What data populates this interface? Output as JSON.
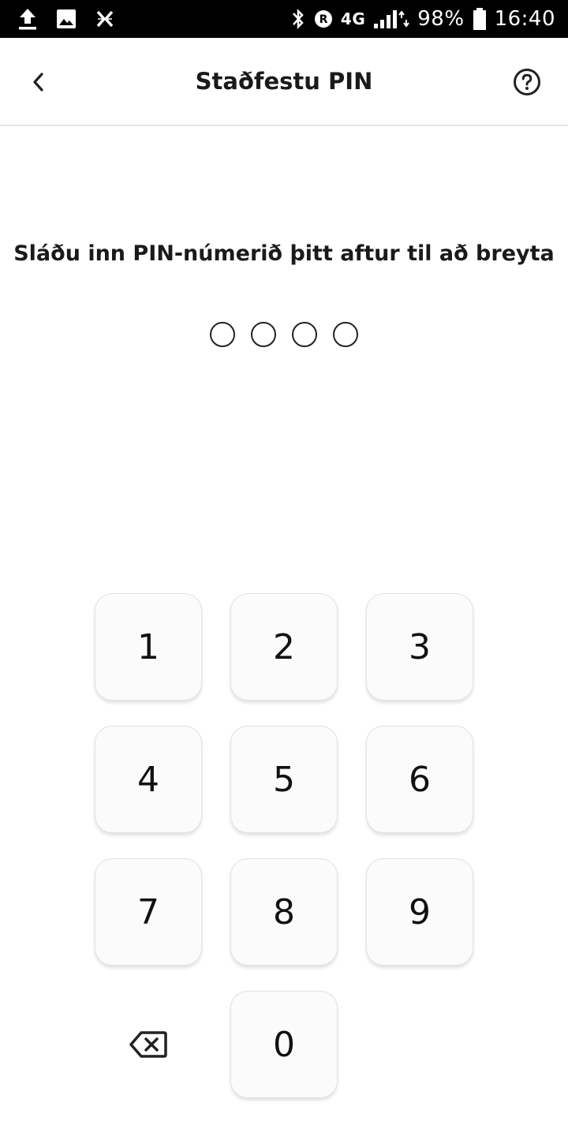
{
  "status_bar": {
    "left_icons": [
      "upload-icon",
      "image-icon",
      "app-notification-icon"
    ],
    "right_icons": [
      "bluetooth-icon",
      "roaming-icon",
      "signal-icon",
      "battery-icon"
    ],
    "network": "4G",
    "battery": "98%",
    "time": "16:40"
  },
  "app_bar": {
    "title": "Staðfestu PIN",
    "back_icon": "chevron-left-icon",
    "help_icon": "help-circle-icon"
  },
  "main": {
    "instruction": "Sláðu inn PIN-númerið þitt aftur til að breyta",
    "pin_length": 4,
    "pin_filled": 0
  },
  "keypad": {
    "keys": [
      "1",
      "2",
      "3",
      "4",
      "5",
      "6",
      "7",
      "8",
      "9",
      "0"
    ],
    "backspace_icon": "backspace-icon"
  }
}
